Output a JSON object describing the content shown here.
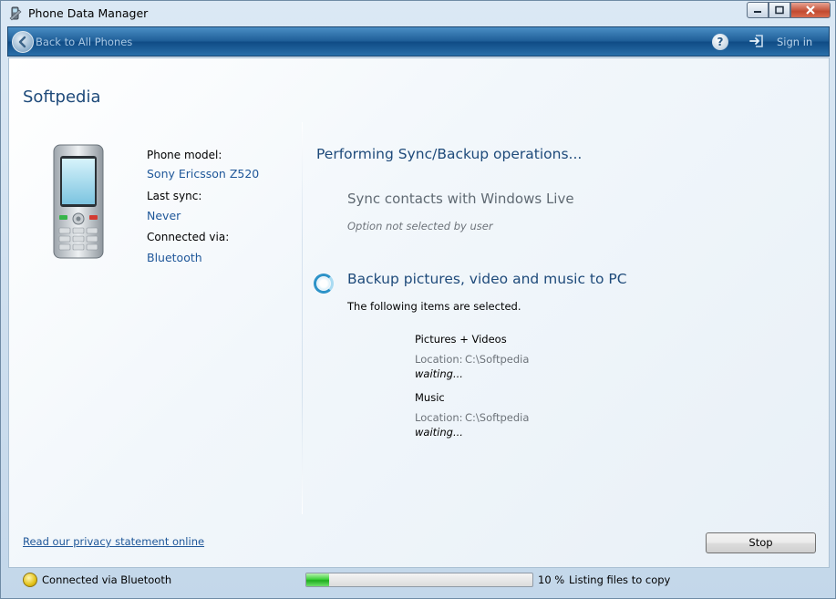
{
  "window": {
    "title": "Phone Data Manager",
    "icons": {
      "app": "phone-tools-icon",
      "minimize": "minimize-icon",
      "maximize": "maximize-icon",
      "close": "close-icon"
    }
  },
  "navbar": {
    "back_label": "Back to All Phones",
    "back_icon": "back-arrow-icon",
    "help_glyph": "?",
    "help_icon": "help-icon",
    "signin_label": "Sign in",
    "signin_icon": "sign-in-icon"
  },
  "account": {
    "name": "Softpedia"
  },
  "phone": {
    "image": "mobile-phone-icon",
    "model_label": "Phone model:",
    "model_value": "Sony Ericsson Z520",
    "last_sync_label": "Last sync:",
    "last_sync_value": "Never",
    "connected_label": "Connected via:",
    "connected_value": "Bluetooth"
  },
  "operations": {
    "heading": "Performing Sync/Backup operations...",
    "sync": {
      "title": "Sync contacts with Windows Live",
      "note": "Option not selected by user"
    },
    "backup": {
      "title": "Backup pictures, video and music to PC",
      "subtitle": "The following items are selected.",
      "items": [
        {
          "name": "Pictures + Videos",
          "location_label": "Location:",
          "location": "C:\\Softpedia",
          "status": "waiting..."
        },
        {
          "name": "Music",
          "location_label": "Location:",
          "location": "C:\\Softpedia",
          "status": "waiting..."
        }
      ]
    }
  },
  "footer": {
    "privacy_link": "Read our privacy statement online",
    "stop_label": "Stop"
  },
  "statusbar": {
    "icon": "connection-status-icon",
    "connection_text": "Connected via Bluetooth",
    "progress_fraction": 0.1,
    "progress_text": "10 %",
    "progress_status": "Listing files to copy"
  },
  "colors": {
    "accent": "#1e4a7a",
    "link": "#1f5799",
    "navbar": "#1f5e98",
    "progress": "#3fd23b"
  }
}
